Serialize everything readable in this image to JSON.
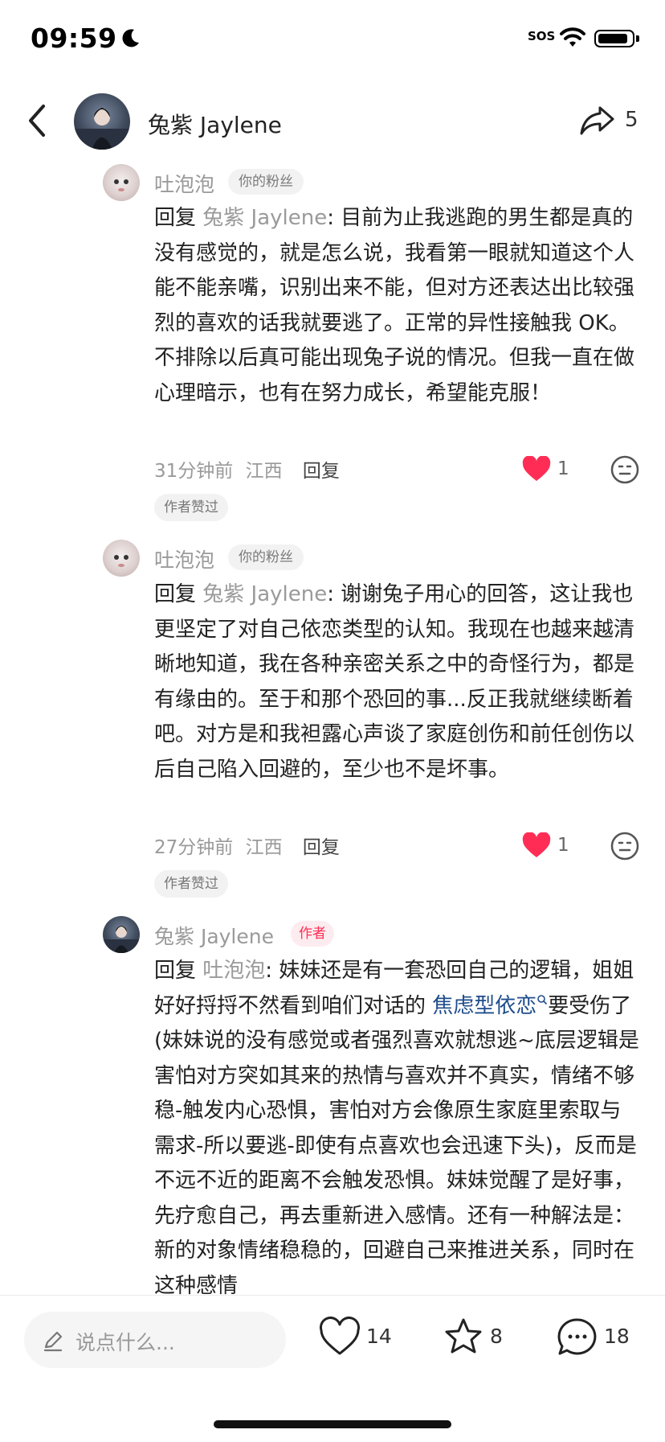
{
  "status_bar": {
    "time": "09:59",
    "sos": "SOS",
    "icons": [
      "moon-icon",
      "wifi-icon",
      "battery-icon"
    ]
  },
  "header": {
    "name": "兔紫 Jaylene",
    "share_count": "5",
    "icons": [
      "back-icon",
      "share-icon"
    ]
  },
  "comments": [
    {
      "author": "吐泡泡",
      "tag": "你的粉丝",
      "reply_prefix": "回复 ",
      "reply_target": "兔紫 Jaylene",
      "text": ": 目前为止我逃跑的男生都是真的没有感觉的，就是怎么说，我看第一眼就知道这个人能不能亲嘴，识别出来不能，但对方还表达出比较强烈的喜欢的话我就要逃了。正常的异性接触我 OK。不排除以后真可能出现兔子说的情况。但我一直在做心理暗示，也有在努力成长，希望能克服！",
      "time": "31分钟前",
      "location": "江西",
      "reply_label": "回复",
      "likes": "1",
      "author_liked": "作者赞过"
    },
    {
      "author": "吐泡泡",
      "tag": "你的粉丝",
      "reply_prefix": "回复 ",
      "reply_target": "兔紫 Jaylene",
      "text": ": 谢谢兔子用心的回答，这让我也更坚定了对自己依恋类型的认知。我现在也越来越清晰地知道，我在各种亲密关系之中的奇怪行为，都是有缘由的。至于和那个恐回的事...反正我就继续断着吧。对方是和我袒露心声谈了家庭创伤和前任创伤以后自己陷入回避的，至少也不是坏事。",
      "time": "27分钟前",
      "location": "江西",
      "reply_label": "回复",
      "likes": "1",
      "author_liked": "作者赞过"
    },
    {
      "author": "兔紫 Jaylene",
      "tag": "作者",
      "reply_prefix": "回复 ",
      "reply_target": "吐泡泡",
      "text_before_link": ": 妹妹还是有一套恐回自己的逻辑，姐姐好好捋捋不然看到咱们对话的 ",
      "link": "焦虑型依恋",
      "text_after_link": "要受伤了 (妹妹说的没有感觉或者强烈喜欢就想逃~底层逻辑是害怕对方突如其来的热情与喜欢并不真实，情绪不够稳-触发内心恐惧，害怕对方会像原生家庭里索取与需求-所以要逃-即使有点喜欢也会迅速下头)，反而是不远不近的距离不会触发恐惧。妹妹觉醒了是好事，先疗愈自己，再去重新进入感情。还有一种解法是：新的对象情绪稳稳的，回避自己来推进关系，同时在这种感情"
    }
  ],
  "bottom_bar": {
    "placeholder": "说点什么...",
    "likes": "14",
    "favorites": "8",
    "comments": "18"
  }
}
